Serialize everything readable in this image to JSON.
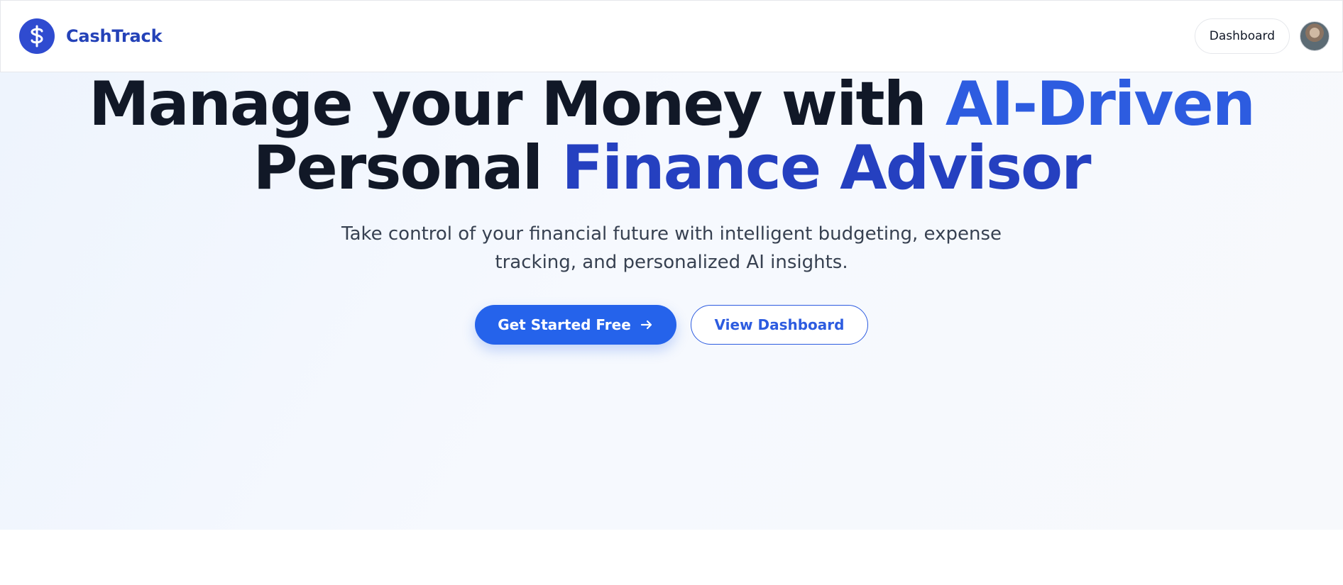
{
  "header": {
    "brand_name": "CashTrack",
    "logo_icon": "dollar-sign-icon",
    "dashboard_label": "Dashboard",
    "avatar_icon": "user-avatar"
  },
  "hero": {
    "headline_part1": "Manage your Money with ",
    "headline_accent1": "AI-Driven",
    "headline_part2": "Personal ",
    "headline_accent2": "Finance Advisor",
    "subtitle": "Take control of your financial future with intelligent budgeting, expense tracking, and personalized AI insights.",
    "primary_cta": "Get Started Free",
    "primary_cta_icon": "arrow-right-icon",
    "secondary_cta": "View Dashboard"
  },
  "colors": {
    "brand": "#2442b8",
    "accent": "#2563eb",
    "accent_text": "#2d5ce0",
    "heading": "#111827",
    "hero_background": "#eef4fd"
  }
}
